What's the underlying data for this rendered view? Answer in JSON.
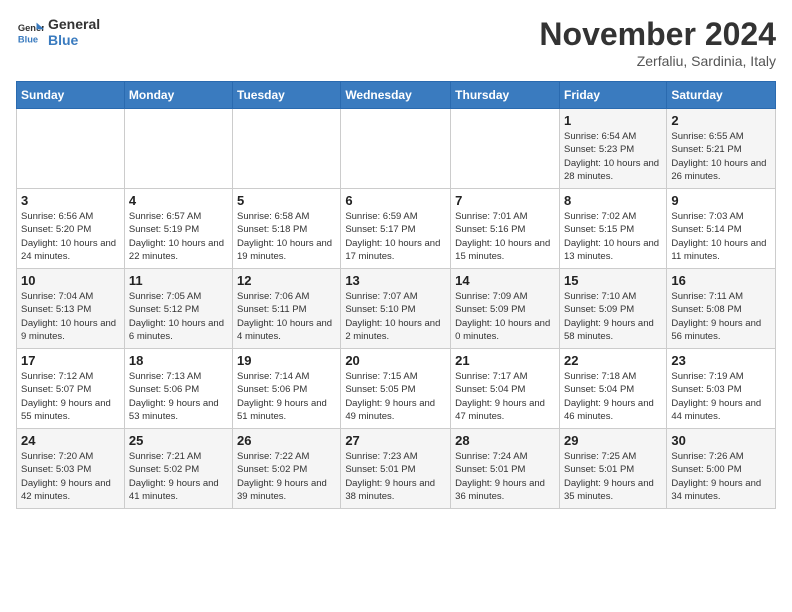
{
  "logo": {
    "text_general": "General",
    "text_blue": "Blue"
  },
  "header": {
    "month_title": "November 2024",
    "location": "Zerfaliu, Sardinia, Italy"
  },
  "days_of_week": [
    "Sunday",
    "Monday",
    "Tuesday",
    "Wednesday",
    "Thursday",
    "Friday",
    "Saturday"
  ],
  "weeks": [
    [
      {
        "day": "",
        "info": ""
      },
      {
        "day": "",
        "info": ""
      },
      {
        "day": "",
        "info": ""
      },
      {
        "day": "",
        "info": ""
      },
      {
        "day": "",
        "info": ""
      },
      {
        "day": "1",
        "info": "Sunrise: 6:54 AM\nSunset: 5:23 PM\nDaylight: 10 hours and 28 minutes."
      },
      {
        "day": "2",
        "info": "Sunrise: 6:55 AM\nSunset: 5:21 PM\nDaylight: 10 hours and 26 minutes."
      }
    ],
    [
      {
        "day": "3",
        "info": "Sunrise: 6:56 AM\nSunset: 5:20 PM\nDaylight: 10 hours and 24 minutes."
      },
      {
        "day": "4",
        "info": "Sunrise: 6:57 AM\nSunset: 5:19 PM\nDaylight: 10 hours and 22 minutes."
      },
      {
        "day": "5",
        "info": "Sunrise: 6:58 AM\nSunset: 5:18 PM\nDaylight: 10 hours and 19 minutes."
      },
      {
        "day": "6",
        "info": "Sunrise: 6:59 AM\nSunset: 5:17 PM\nDaylight: 10 hours and 17 minutes."
      },
      {
        "day": "7",
        "info": "Sunrise: 7:01 AM\nSunset: 5:16 PM\nDaylight: 10 hours and 15 minutes."
      },
      {
        "day": "8",
        "info": "Sunrise: 7:02 AM\nSunset: 5:15 PM\nDaylight: 10 hours and 13 minutes."
      },
      {
        "day": "9",
        "info": "Sunrise: 7:03 AM\nSunset: 5:14 PM\nDaylight: 10 hours and 11 minutes."
      }
    ],
    [
      {
        "day": "10",
        "info": "Sunrise: 7:04 AM\nSunset: 5:13 PM\nDaylight: 10 hours and 9 minutes."
      },
      {
        "day": "11",
        "info": "Sunrise: 7:05 AM\nSunset: 5:12 PM\nDaylight: 10 hours and 6 minutes."
      },
      {
        "day": "12",
        "info": "Sunrise: 7:06 AM\nSunset: 5:11 PM\nDaylight: 10 hours and 4 minutes."
      },
      {
        "day": "13",
        "info": "Sunrise: 7:07 AM\nSunset: 5:10 PM\nDaylight: 10 hours and 2 minutes."
      },
      {
        "day": "14",
        "info": "Sunrise: 7:09 AM\nSunset: 5:09 PM\nDaylight: 10 hours and 0 minutes."
      },
      {
        "day": "15",
        "info": "Sunrise: 7:10 AM\nSunset: 5:09 PM\nDaylight: 9 hours and 58 minutes."
      },
      {
        "day": "16",
        "info": "Sunrise: 7:11 AM\nSunset: 5:08 PM\nDaylight: 9 hours and 56 minutes."
      }
    ],
    [
      {
        "day": "17",
        "info": "Sunrise: 7:12 AM\nSunset: 5:07 PM\nDaylight: 9 hours and 55 minutes."
      },
      {
        "day": "18",
        "info": "Sunrise: 7:13 AM\nSunset: 5:06 PM\nDaylight: 9 hours and 53 minutes."
      },
      {
        "day": "19",
        "info": "Sunrise: 7:14 AM\nSunset: 5:06 PM\nDaylight: 9 hours and 51 minutes."
      },
      {
        "day": "20",
        "info": "Sunrise: 7:15 AM\nSunset: 5:05 PM\nDaylight: 9 hours and 49 minutes."
      },
      {
        "day": "21",
        "info": "Sunrise: 7:17 AM\nSunset: 5:04 PM\nDaylight: 9 hours and 47 minutes."
      },
      {
        "day": "22",
        "info": "Sunrise: 7:18 AM\nSunset: 5:04 PM\nDaylight: 9 hours and 46 minutes."
      },
      {
        "day": "23",
        "info": "Sunrise: 7:19 AM\nSunset: 5:03 PM\nDaylight: 9 hours and 44 minutes."
      }
    ],
    [
      {
        "day": "24",
        "info": "Sunrise: 7:20 AM\nSunset: 5:03 PM\nDaylight: 9 hours and 42 minutes."
      },
      {
        "day": "25",
        "info": "Sunrise: 7:21 AM\nSunset: 5:02 PM\nDaylight: 9 hours and 41 minutes."
      },
      {
        "day": "26",
        "info": "Sunrise: 7:22 AM\nSunset: 5:02 PM\nDaylight: 9 hours and 39 minutes."
      },
      {
        "day": "27",
        "info": "Sunrise: 7:23 AM\nSunset: 5:01 PM\nDaylight: 9 hours and 38 minutes."
      },
      {
        "day": "28",
        "info": "Sunrise: 7:24 AM\nSunset: 5:01 PM\nDaylight: 9 hours and 36 minutes."
      },
      {
        "day": "29",
        "info": "Sunrise: 7:25 AM\nSunset: 5:01 PM\nDaylight: 9 hours and 35 minutes."
      },
      {
        "day": "30",
        "info": "Sunrise: 7:26 AM\nSunset: 5:00 PM\nDaylight: 9 hours and 34 minutes."
      }
    ]
  ]
}
